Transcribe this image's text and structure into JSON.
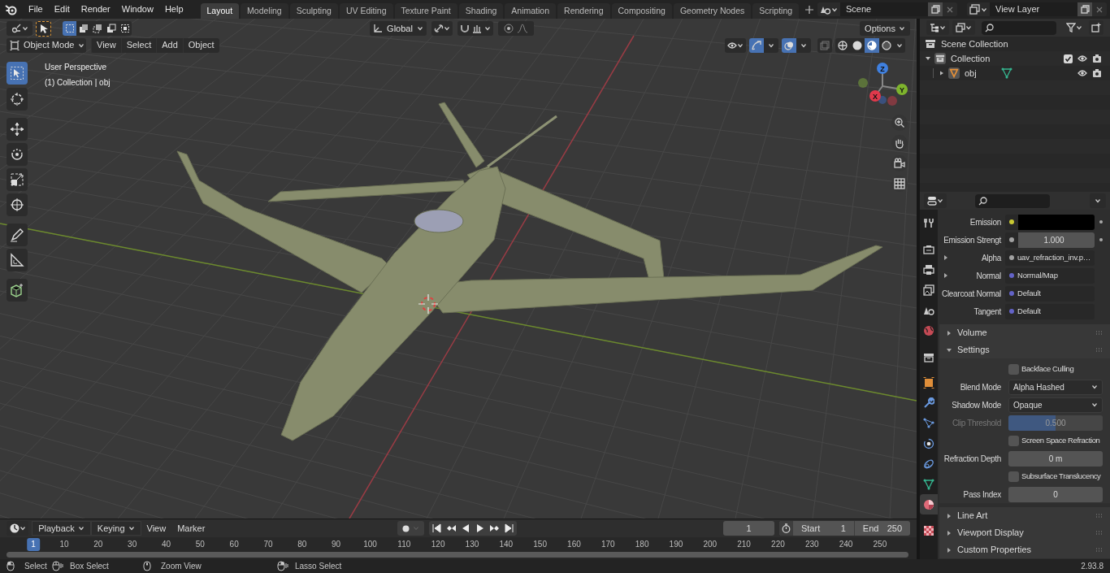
{
  "top_menu": [
    "File",
    "Edit",
    "Render",
    "Window",
    "Help"
  ],
  "workspaces": [
    {
      "label": "Layout",
      "selected": true
    },
    {
      "label": "Modeling",
      "selected": false
    },
    {
      "label": "Sculpting",
      "selected": false
    },
    {
      "label": "UV Editing",
      "selected": false
    },
    {
      "label": "Texture Paint",
      "selected": false
    },
    {
      "label": "Shading",
      "selected": false
    },
    {
      "label": "Animation",
      "selected": false
    },
    {
      "label": "Rendering",
      "selected": false
    },
    {
      "label": "Compositing",
      "selected": false
    },
    {
      "label": "Geometry Nodes",
      "selected": false
    },
    {
      "label": "Scripting",
      "selected": false
    }
  ],
  "scene": "Scene",
  "view_layer": "View Layer",
  "tool_header": {
    "select_modes": [
      {
        "selected": true
      },
      {
        "selected": false
      },
      {
        "selected": false
      },
      {
        "selected": false
      },
      {
        "selected": false
      }
    ],
    "orientation": "Global",
    "options": "Options"
  },
  "viewport_header": {
    "mode": "Object Mode",
    "gizmos_on": true,
    "overlays_on": true,
    "menus": [
      "View",
      "Select",
      "Add",
      "Object"
    ],
    "shading": [
      {
        "selected": false
      },
      {
        "selected": false
      },
      {
        "selected": true
      },
      {
        "selected": false
      }
    ]
  },
  "viewport": {
    "perspective": "User Perspective",
    "context": "(1) Collection | obj",
    "gizmo_axes": [
      "X",
      "Y",
      "Z"
    ]
  },
  "toolbar": [
    {
      "kind": "select",
      "selected": true
    },
    {
      "kind": "cursor",
      "selected": false
    },
    {
      "kind": "move",
      "selected": false
    },
    {
      "kind": "rotate",
      "selected": false
    },
    {
      "kind": "scale",
      "selected": false
    },
    {
      "kind": "transform",
      "selected": false
    },
    {
      "kind": "annotate",
      "selected": false
    },
    {
      "kind": "measure",
      "selected": false
    },
    {
      "kind": "add_cube",
      "selected": false
    }
  ],
  "outliner": {
    "items": [
      {
        "label": "Scene Collection",
        "kind": "scene",
        "children": [
          {
            "label": "Collection",
            "kind": "collection",
            "expanded": true,
            "checked": true,
            "children": [
              {
                "label": "obj",
                "kind": "object",
                "expanded": false
              }
            ]
          }
        ]
      }
    ]
  },
  "properties": {
    "tabs": [
      {
        "kind": "tool",
        "selected": false
      },
      {
        "kind": "render",
        "selected": false
      },
      {
        "kind": "output",
        "selected": false
      },
      {
        "kind": "view_layer",
        "selected": false
      },
      {
        "kind": "scene",
        "selected": false
      },
      {
        "kind": "world",
        "selected": false
      },
      {
        "kind": "collection",
        "selected": false
      },
      {
        "kind": "object",
        "selected": false
      },
      {
        "kind": "modifier",
        "selected": false
      },
      {
        "kind": "particles",
        "selected": false
      },
      {
        "kind": "physics",
        "selected": false
      },
      {
        "kind": "constraints",
        "selected": false
      },
      {
        "kind": "data",
        "selected": false
      },
      {
        "kind": "material",
        "selected": true
      },
      {
        "kind": "texture",
        "selected": false
      }
    ],
    "rows": [
      {
        "kind": "color_socket",
        "label": "Emission",
        "color": "#c8c832"
      },
      {
        "kind": "number_socket",
        "label": "Emission Strengt",
        "color": "#a1a1a1",
        "value": "1.000"
      },
      {
        "kind": "expandable_socket",
        "label": "Alpha",
        "color": "#a1a1a1",
        "value": "uav_refraction_inv.p…",
        "expanded": false
      },
      {
        "kind": "expandable_socket",
        "label": "Normal",
        "color": "#6363c7",
        "value": "Normal/Map",
        "expanded": false
      },
      {
        "kind": "link_socket",
        "label": "Clearcoat Normal",
        "color": "#6363c7",
        "value": "Default"
      },
      {
        "kind": "link_socket",
        "label": "Tangent",
        "color": "#6363c7",
        "value": "Default"
      },
      {
        "kind": "panel",
        "label": "Volume",
        "expanded": false
      },
      {
        "kind": "panel",
        "label": "Settings",
        "expanded": true
      },
      {
        "kind": "checkbox",
        "label": "Backface Culling",
        "checked": false
      },
      {
        "kind": "dropdown",
        "label": "Blend Mode",
        "value": "Alpha Hashed"
      },
      {
        "kind": "dropdown",
        "label": "Shadow Mode",
        "value": "Opaque"
      },
      {
        "kind": "slider",
        "label": "Clip Threshold",
        "value": "0.500",
        "level": 0.5,
        "disabled": true
      },
      {
        "kind": "checkbox",
        "label": "Screen Space Refraction",
        "checked": false
      },
      {
        "kind": "number",
        "label": "Refraction Depth",
        "value": "0 m"
      },
      {
        "kind": "checkbox",
        "label": "Subsurface Translucency",
        "checked": false
      },
      {
        "kind": "number",
        "label": "Pass Index",
        "value": "0"
      },
      {
        "kind": "panel",
        "label": "Line Art",
        "expanded": false
      },
      {
        "kind": "panel",
        "label": "Viewport Display",
        "expanded": false
      },
      {
        "kind": "panel",
        "label": "Custom Properties",
        "expanded": false
      }
    ]
  },
  "timeline": {
    "menus": [
      "Playback",
      "Keying",
      "View",
      "Marker"
    ],
    "current_frame": "1",
    "start_label": "Start",
    "start": "1",
    "end_label": "End",
    "end": "250",
    "ticks": [
      {
        "label": "1",
        "selected": true
      },
      {
        "label": "10",
        "selected": false
      },
      {
        "label": "20",
        "selected": false
      },
      {
        "label": "30",
        "selected": false
      },
      {
        "label": "40",
        "selected": false
      },
      {
        "label": "50",
        "selected": false
      },
      {
        "label": "60",
        "selected": false
      },
      {
        "label": "70",
        "selected": false
      },
      {
        "label": "80",
        "selected": false
      },
      {
        "label": "90",
        "selected": false
      },
      {
        "label": "100",
        "selected": false
      },
      {
        "label": "110",
        "selected": false
      },
      {
        "label": "120",
        "selected": false
      },
      {
        "label": "130",
        "selected": false
      },
      {
        "label": "140",
        "selected": false
      },
      {
        "label": "150",
        "selected": false
      },
      {
        "label": "160",
        "selected": false
      },
      {
        "label": "170",
        "selected": false
      },
      {
        "label": "180",
        "selected": false
      },
      {
        "label": "190",
        "selected": false
      },
      {
        "label": "200",
        "selected": false
      },
      {
        "label": "210",
        "selected": false
      },
      {
        "label": "220",
        "selected": false
      },
      {
        "label": "230",
        "selected": false
      },
      {
        "label": "240",
        "selected": false
      },
      {
        "label": "250",
        "selected": false
      }
    ]
  },
  "status_bar": {
    "hints": [
      "Select",
      "Box Select",
      "Zoom View",
      "Lasso Select"
    ],
    "version": "2.93.8"
  }
}
